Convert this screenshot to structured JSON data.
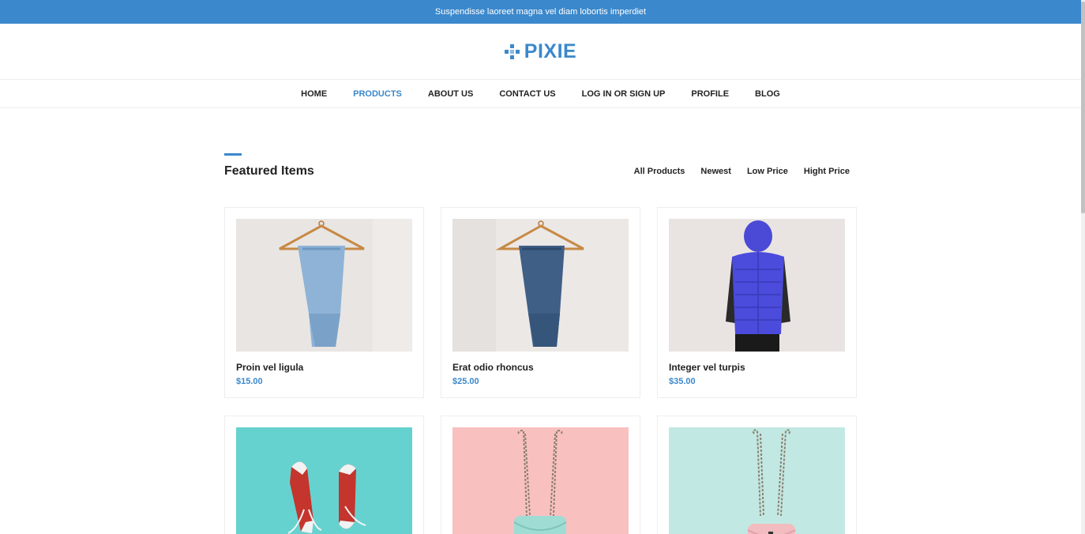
{
  "announcement": "Suspendisse laoreet magna vel diam lobortis imperdiet",
  "brand": {
    "name": "PIXIE",
    "icon": "diamond-pixel-icon",
    "color": "#3b88cc"
  },
  "nav": {
    "items": [
      {
        "label": "HOME"
      },
      {
        "label": "PRODUCTS",
        "active": true
      },
      {
        "label": "ABOUT US"
      },
      {
        "label": "CONTACT US"
      },
      {
        "label": "LOG IN OR SIGN UP"
      },
      {
        "label": "PROFILE"
      },
      {
        "label": "BLOG"
      }
    ]
  },
  "section": {
    "title": "Featured Items"
  },
  "filters": [
    "All Products",
    "Newest",
    "Low Price",
    "Hight Price"
  ],
  "products": [
    {
      "name": "Proin vel ligula",
      "price": "$15.00",
      "image": "light-jeans-on-hanger"
    },
    {
      "name": "Erat odio rhoncus",
      "price": "$25.00",
      "image": "dark-jeans-on-hanger"
    },
    {
      "name": "Integer vel turpis",
      "price": "$35.00",
      "image": "blue-puffer-vest"
    },
    {
      "name": "",
      "price": "",
      "image": "red-sneakers-on-teal"
    },
    {
      "name": "",
      "price": "",
      "image": "mint-bag-on-pink"
    },
    {
      "name": "",
      "price": "",
      "image": "pink-bag-on-mint"
    }
  ]
}
